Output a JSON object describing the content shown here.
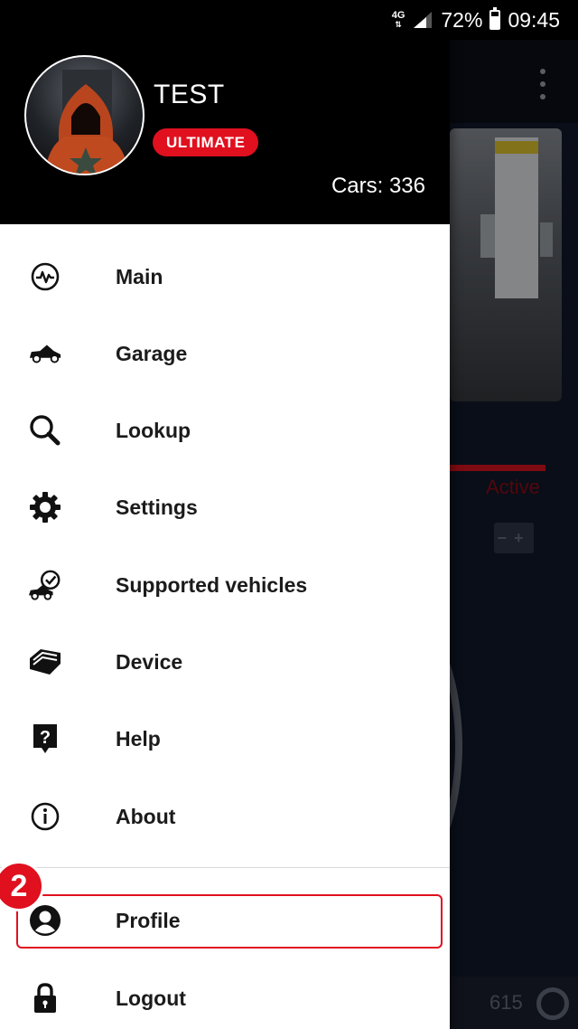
{
  "status_bar": {
    "network": "4G",
    "battery_percent": "72%",
    "time": "09:45"
  },
  "drawer": {
    "user_name": "TEST",
    "plan_badge": "ULTIMATE",
    "cars_count": "Cars: 336",
    "menu_items": [
      {
        "label": "Main",
        "icon": "pulse-icon"
      },
      {
        "label": "Garage",
        "icon": "car-icon"
      },
      {
        "label": "Lookup",
        "icon": "search-icon"
      },
      {
        "label": "Settings",
        "icon": "gear-icon"
      },
      {
        "label": "Supported vehicles",
        "icon": "car-check-icon"
      },
      {
        "label": "Device",
        "icon": "obd-device-icon"
      },
      {
        "label": "Help",
        "icon": "help-icon"
      },
      {
        "label": "About",
        "icon": "info-icon"
      },
      {
        "label": "Profile",
        "icon": "person-icon"
      },
      {
        "label": "Logout",
        "icon": "lock-icon"
      }
    ],
    "step_badge": "2"
  },
  "background": {
    "status_text": "Active",
    "counter": "615"
  },
  "colors": {
    "accent": "#e0101f",
    "header_bg": "#000000",
    "drawer_bg": "#ffffff"
  }
}
